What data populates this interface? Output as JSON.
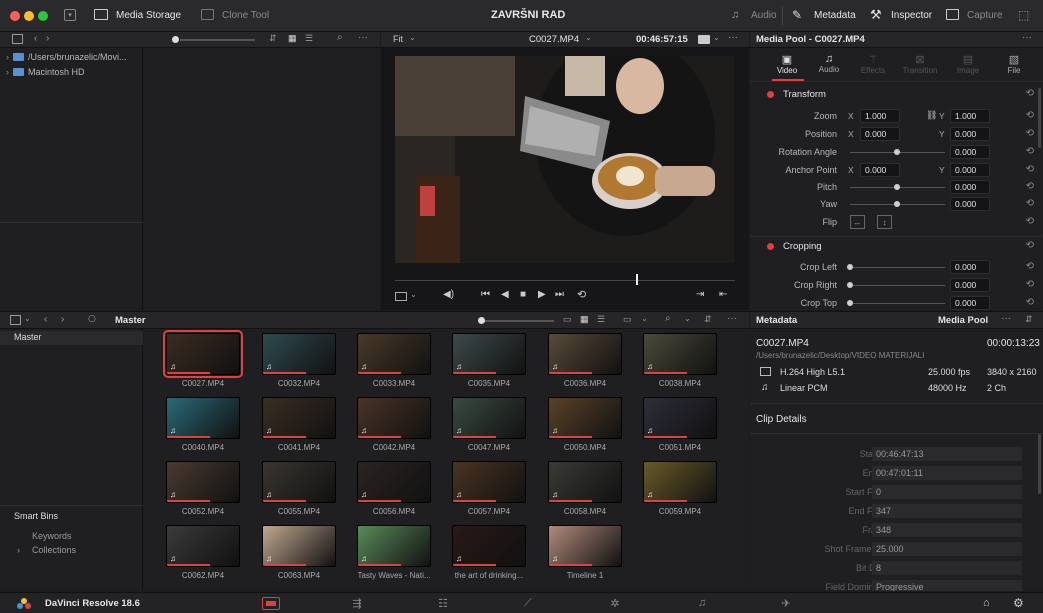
{
  "window": {
    "title": "ZAVRŠNI RAD"
  },
  "topbar": {
    "media_storage": "Media Storage",
    "clone_tool": "Clone Tool",
    "audio": "Audio",
    "metadata": "Metadata",
    "inspector": "Inspector",
    "capture": "Capture"
  },
  "storage": {
    "items": [
      "/Users/brunazelic/Movi...",
      "Macintosh HD"
    ]
  },
  "viewer": {
    "fit": "Fit",
    "clip_name": "C0027.MP4",
    "timecode": "00:46:57:15",
    "playhead_pct": 71
  },
  "inspector": {
    "title": "Media Pool - C0027.MP4",
    "tabs": [
      "Video",
      "Audio",
      "Effects",
      "Transition",
      "Image",
      "File"
    ],
    "transform": {
      "label": "Transform",
      "zoom": {
        "label": "Zoom",
        "x": "1.000",
        "y": "1.000"
      },
      "position": {
        "label": "Position",
        "x": "0.000",
        "y": "0.000"
      },
      "rotation": {
        "label": "Rotation Angle",
        "value": "0.000"
      },
      "anchor": {
        "label": "Anchor Point",
        "x": "0.000",
        "y": "0.000"
      },
      "pitch": {
        "label": "Pitch",
        "value": "0.000"
      },
      "yaw": {
        "label": "Yaw",
        "value": "0.000"
      },
      "flip": {
        "label": "Flip"
      }
    },
    "cropping": {
      "label": "Cropping",
      "crop_left": {
        "label": "Crop Left",
        "value": "0.000"
      },
      "crop_right": {
        "label": "Crop Right",
        "value": "0.000"
      },
      "crop_top": {
        "label": "Crop Top",
        "value": "0.000"
      }
    }
  },
  "bins": {
    "panel_title": "Master",
    "master": "Master",
    "smart_bins": "Smart Bins",
    "keywords": "Keywords",
    "collections": "Collections"
  },
  "clips": [
    {
      "name": "C0027.MP4",
      "color": "#3a2c22",
      "selected": true
    },
    {
      "name": "C0032.MP4",
      "color": "#2f4a52"
    },
    {
      "name": "C0033.MP4",
      "color": "#4a3a2a"
    },
    {
      "name": "C0035.MP4",
      "color": "#3d4a4a"
    },
    {
      "name": "C0036.MP4",
      "color": "#5a4a3a"
    },
    {
      "name": "C0038.MP4",
      "color": "#4a4a3a"
    },
    {
      "name": "C0040.MP4",
      "color": "#2a6a78"
    },
    {
      "name": "C0041.MP4",
      "color": "#3a2e22"
    },
    {
      "name": "C0042.MP4",
      "color": "#4a3426"
    },
    {
      "name": "C0047.MP4",
      "color": "#3a4a42"
    },
    {
      "name": "C0050.MP4",
      "color": "#5a4228"
    },
    {
      "name": "C0051.MP4",
      "color": "#2e2e3a"
    },
    {
      "name": "C0052.MP4",
      "color": "#4a3a30"
    },
    {
      "name": "C0055.MP4",
      "color": "#3a3630"
    },
    {
      "name": "C0056.MP4",
      "color": "#2a2422"
    },
    {
      "name": "C0057.MP4",
      "color": "#4a3422"
    },
    {
      "name": "C0058.MP4",
      "color": "#3a3a36"
    },
    {
      "name": "C0059.MP4",
      "color": "#6a5a2a"
    },
    {
      "name": "C0062.MP4",
      "color": "#3a3a3a"
    },
    {
      "name": "C0063.MP4",
      "color": "#c0a890"
    },
    {
      "name": "Tasty Waves - Nati...",
      "color": "#5a8a5a"
    },
    {
      "name": "the art of drinking...",
      "color": "#2a1818"
    },
    {
      "name": "Timeline 1",
      "color": "#b08a7a"
    }
  ],
  "metadata": {
    "panel_title": "Metadata",
    "media_pool_label": "Media Pool",
    "clip": "C0027.MP4",
    "duration": "00:00:13:23",
    "path": "/Users/brunazelic/Desktop/VIDEO MATERIJALI",
    "video_codec": "H.264 High L5.1",
    "fps": "25.000 fps",
    "resolution": "3840 x 2160",
    "audio_codec": "Linear PCM",
    "sample_rate": "48000 Hz",
    "channels": "2 Ch",
    "clip_details": "Clip Details",
    "start_tc": {
      "label": "Start TC",
      "value": "00:46:47:13"
    },
    "end_tc": {
      "label": "End TC",
      "value": "00:47:01:11"
    },
    "start_frame": {
      "label": "Start Frame",
      "value": "0"
    },
    "end_frame": {
      "label": "End Frame",
      "value": "347"
    },
    "frames": {
      "label": "Frames",
      "value": "348"
    },
    "shot_frame_rate": {
      "label": "Shot Frame Rate",
      "value": "25.000"
    },
    "bit_depth": {
      "label": "Bit Depth",
      "value": "8"
    },
    "field_dominance": {
      "label": "Field Dominance",
      "value": "Progressive"
    }
  },
  "footer": {
    "app_name": "DaVinci Resolve 18.6"
  },
  "colors": {
    "accent_red": "#e04040",
    "panel": "#1f1f21",
    "header": "#262628"
  }
}
